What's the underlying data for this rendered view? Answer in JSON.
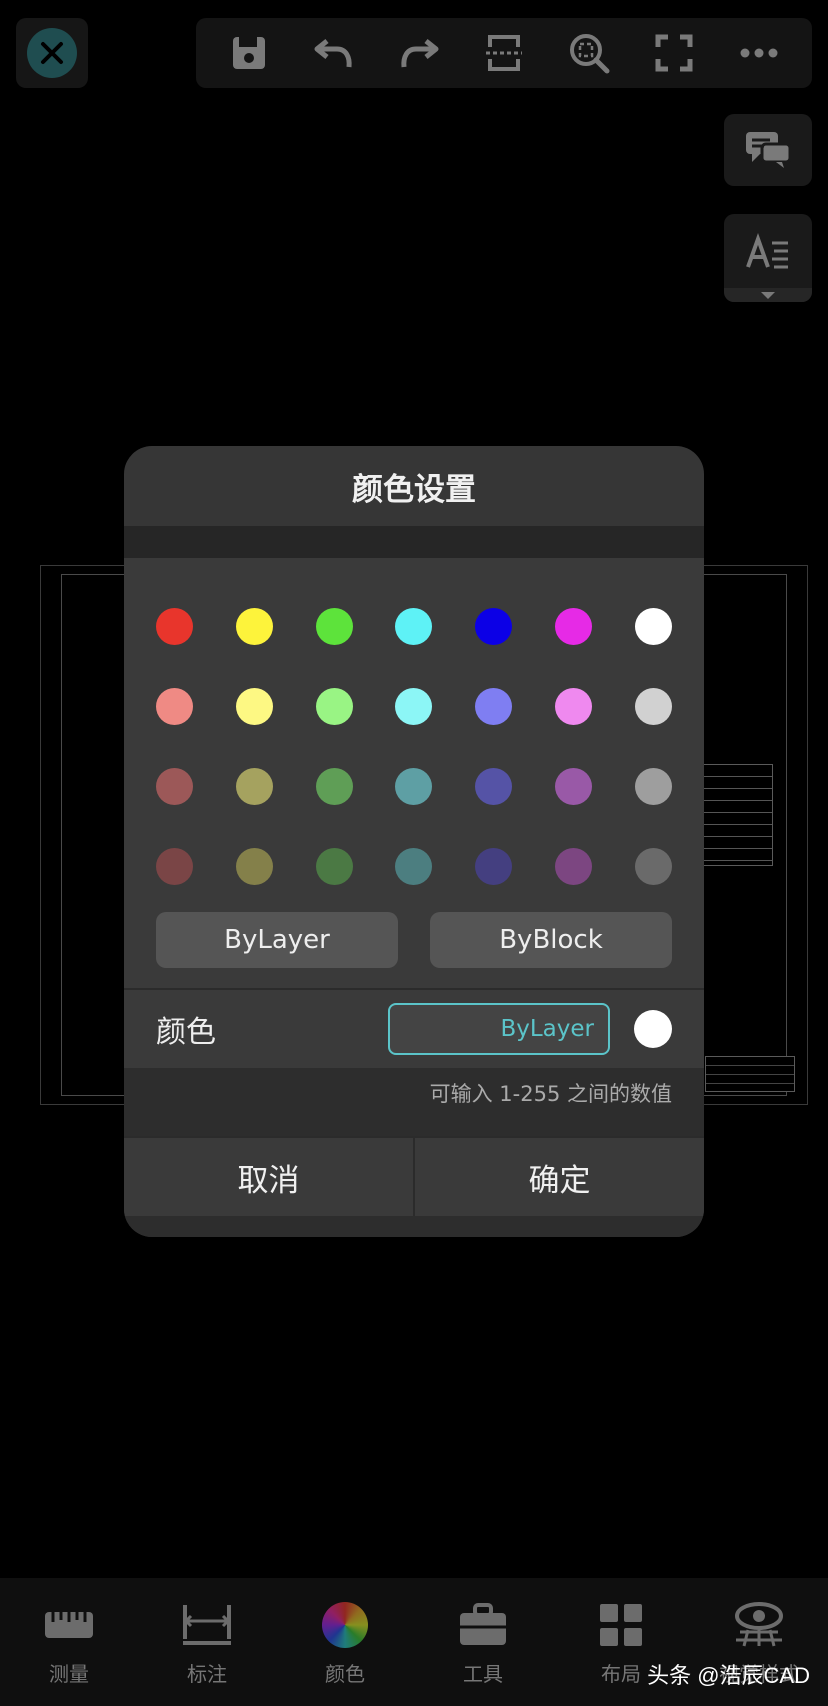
{
  "toolbar": {
    "icons": [
      "close-icon",
      "save-icon",
      "undo-icon",
      "redo-icon",
      "split-icon",
      "zoom-fit-icon",
      "fullscreen-icon",
      "more-icon"
    ]
  },
  "side": {
    "icons": [
      "comment-icon",
      "text-style-icon"
    ]
  },
  "dialog": {
    "title": "颜色设置",
    "palette": [
      [
        "#e8352c",
        "#fdf33b",
        "#5de33b",
        "#5ef2f6",
        "#0c00e6",
        "#e62ae6",
        "#ffffff"
      ],
      [
        "#ef8a84",
        "#fdf883",
        "#99f484",
        "#8cf6f6",
        "#7f7ef2",
        "#ef89ef",
        "#d1d1d1"
      ],
      [
        "#9c5858",
        "#a5a25f",
        "#5f9e56",
        "#5e9fa4",
        "#5553a6",
        "#9959a7",
        "#9e9e9e"
      ],
      [
        "#7a4546",
        "#84804a",
        "#4b7944",
        "#4c7e80",
        "#443f80",
        "#7c4681",
        "#6a6a6a"
      ]
    ],
    "bylayer_label": "ByLayer",
    "byblock_label": "ByBlock",
    "color_label": "颜色",
    "color_value": "ByLayer",
    "current_color": "#ffffff",
    "hint": "可输入 1-255 之间的数值",
    "cancel_label": "取消",
    "confirm_label": "确定"
  },
  "bottom_nav": {
    "items": [
      {
        "label": "测量",
        "icon": "ruler-icon"
      },
      {
        "label": "标注",
        "icon": "dimension-icon"
      },
      {
        "label": "颜色",
        "icon": "color-wheel-icon"
      },
      {
        "label": "工具",
        "icon": "toolbox-icon"
      },
      {
        "label": "布局",
        "icon": "layout-icon"
      },
      {
        "label": "视觉样式",
        "icon": "eye-icon"
      }
    ]
  },
  "watermark": "头条 @浩辰CAD",
  "colors": {
    "accent": "#5bc4c9",
    "dialog_bg": "#363636",
    "background": "#000000"
  }
}
